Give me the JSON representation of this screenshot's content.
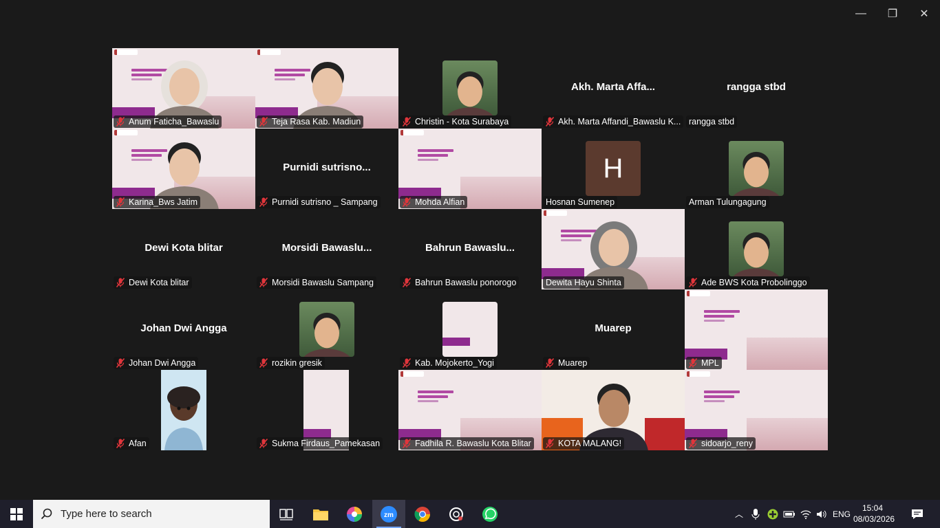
{
  "window_controls": {
    "minimize": "—",
    "restore": "❐",
    "close": "✕"
  },
  "participants": [
    {
      "name": "Anum Faticha_Bawaslu",
      "kind": "slide-person",
      "speaking": true
    },
    {
      "name": "Teja Rasa Kab. Madiun",
      "kind": "slide-person"
    },
    {
      "name": "Christin - Kota Surabaya",
      "kind": "photo"
    },
    {
      "name": "Akh. Marta Affandi_Bawaslu K...",
      "display_name": "Akh. Marta Affa...",
      "kind": "name"
    },
    {
      "name": "rangga stbd",
      "display_name": "rangga stbd",
      "kind": "name"
    },
    {
      "name": "Karina_Bws Jatim",
      "kind": "slide-person"
    },
    {
      "name": "Purnidi sutrisno _ Sampang",
      "display_name": "Purnidi  sutrisno...",
      "kind": "name"
    },
    {
      "name": "Mohda Alfian",
      "kind": "slide"
    },
    {
      "name": "Hosnan Sumenep",
      "kind": "avatar",
      "initial": "H"
    },
    {
      "name": "Arman Tulungagung",
      "kind": "photo"
    },
    {
      "name": "Dewi Kota blitar",
      "display_name": "Dewi Kota blitar",
      "kind": "name"
    },
    {
      "name": "Morsidi Bawaslu Sampang",
      "display_name": "Morsidi  Bawaslu...",
      "kind": "name"
    },
    {
      "name": "Bahrun Bawaslu ponorogo",
      "display_name": "Bahrun  Bawaslu...",
      "kind": "name"
    },
    {
      "name": "Dewita Hayu Shinta",
      "kind": "slide-person"
    },
    {
      "name": "Ade BWS Kota Probolinggo",
      "kind": "photo"
    },
    {
      "name": "Johan Dwi Angga",
      "display_name": "Johan Dwi Angga",
      "kind": "name"
    },
    {
      "name": "rozikin gresik",
      "kind": "photo"
    },
    {
      "name": "Kab. Mojokerto_Yogi",
      "kind": "slide-thumb"
    },
    {
      "name": "Muarep",
      "display_name": "Muarep",
      "kind": "name"
    },
    {
      "name": "MPL",
      "kind": "slide"
    },
    {
      "name": "Afan",
      "kind": "memoji"
    },
    {
      "name": "Sukma Firdaus_Pamekasan",
      "kind": "slide-narrow"
    },
    {
      "name": "Fadhila R. Bawaslu Kota Blitar",
      "kind": "slide"
    },
    {
      "name": "KOTA MALANG!",
      "kind": "event-person"
    },
    {
      "name": "sidoarjo_reny",
      "kind": "slide"
    }
  ],
  "taskbar": {
    "search_placeholder": "Type here to search",
    "apps": [
      "task-view",
      "file-explorer",
      "browser",
      "zoom",
      "chrome",
      "chatgpt",
      "whatsapp"
    ],
    "active_app": "zoom",
    "tray": {
      "language": "ENG",
      "time": "15:04",
      "date": "08/03/2026"
    }
  },
  "colors": {
    "speaking": "#23d18b",
    "slide_purple": "#8e2b8e",
    "taskbar": "#1f1f2b",
    "muted_mic": "#e0353b"
  }
}
